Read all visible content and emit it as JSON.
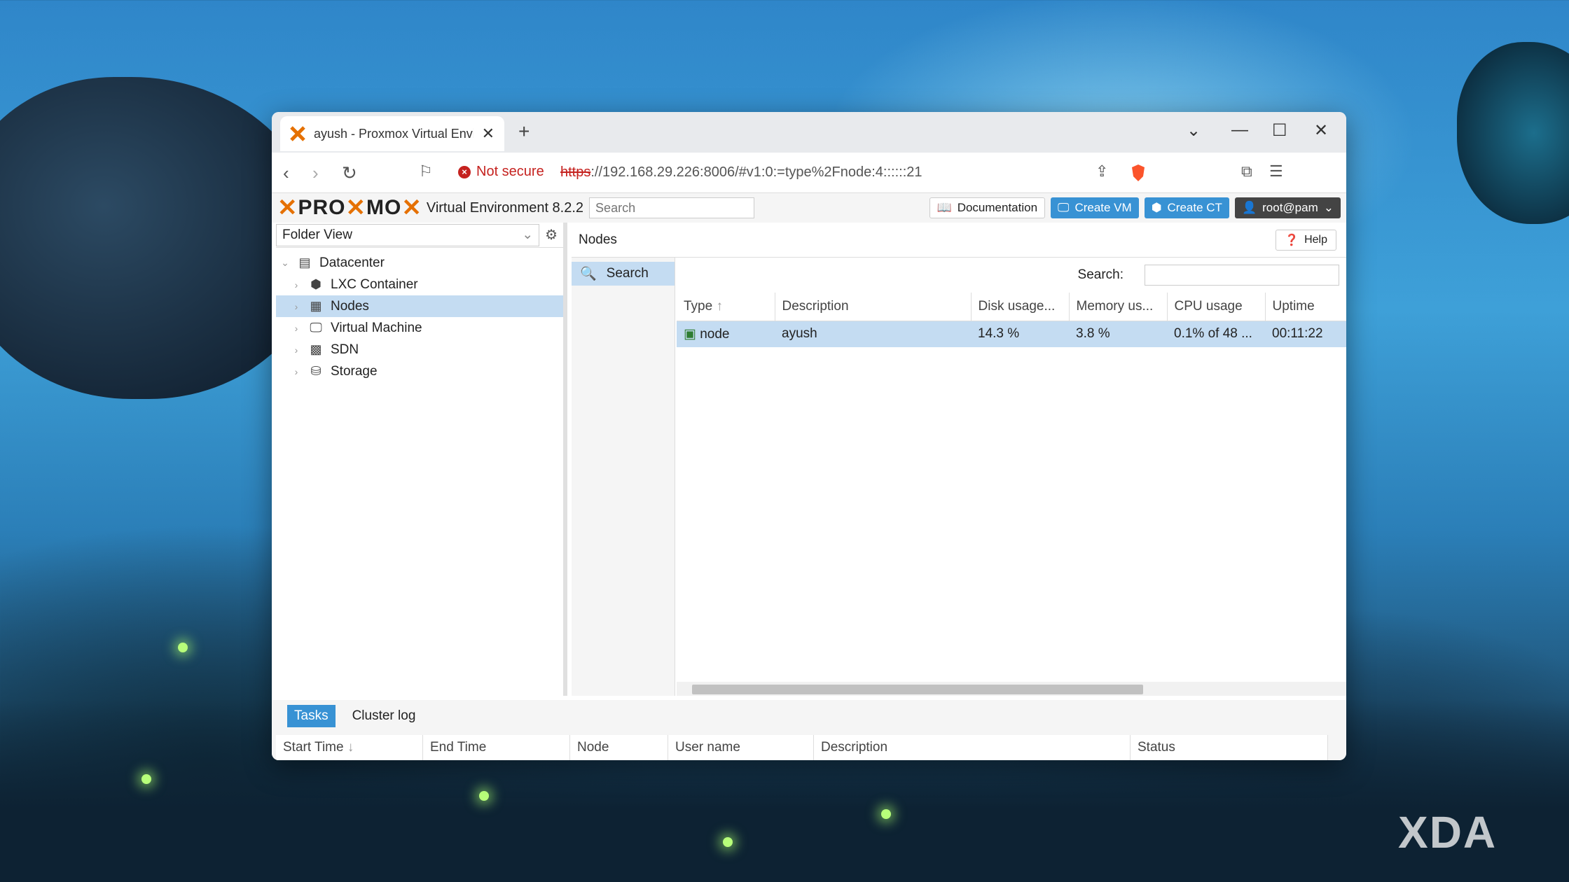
{
  "browser": {
    "tab_title": "ayush - Proxmox Virtual Environment",
    "new_tab": "+",
    "tab_close": "✕",
    "not_secure": "Not secure",
    "url_scheme": "https",
    "url_rest": "://192.168.29.226:8006/#v1:0:=type%2Fnode:4::::::21"
  },
  "header": {
    "logo_left": "PRO",
    "logo_mid": "MO",
    "version": "Virtual Environment 8.2.2",
    "search_placeholder": "Search",
    "documentation": "Documentation",
    "create_vm": "Create VM",
    "create_ct": "Create CT",
    "user": "root@pam"
  },
  "sidebar": {
    "view": "Folder View",
    "tree": [
      {
        "label": "Datacenter"
      },
      {
        "label": "LXC Container"
      },
      {
        "label": "Nodes"
      },
      {
        "label": "Virtual Machine"
      },
      {
        "label": "SDN"
      },
      {
        "label": "Storage"
      }
    ]
  },
  "content": {
    "title": "Nodes",
    "help": "Help",
    "subnav_search": "Search",
    "search_label": "Search:",
    "columns": [
      "Type",
      "Description",
      "Disk usage...",
      "Memory us...",
      "CPU usage",
      "Uptime"
    ],
    "rows": [
      {
        "type": "node",
        "description": "ayush",
        "disk": "14.3 %",
        "memory": "3.8 %",
        "cpu": "0.1% of 48 ...",
        "uptime": "00:11:22"
      }
    ]
  },
  "bottom": {
    "tabs": [
      "Tasks",
      "Cluster log"
    ],
    "columns": [
      "Start Time",
      "End Time",
      "Node",
      "User name",
      "Description",
      "Status"
    ]
  },
  "watermark": "XDA",
  "colors": {
    "accent": "#3892d4",
    "selection": "#c4dcf2",
    "logo_orange": "#e57000"
  }
}
